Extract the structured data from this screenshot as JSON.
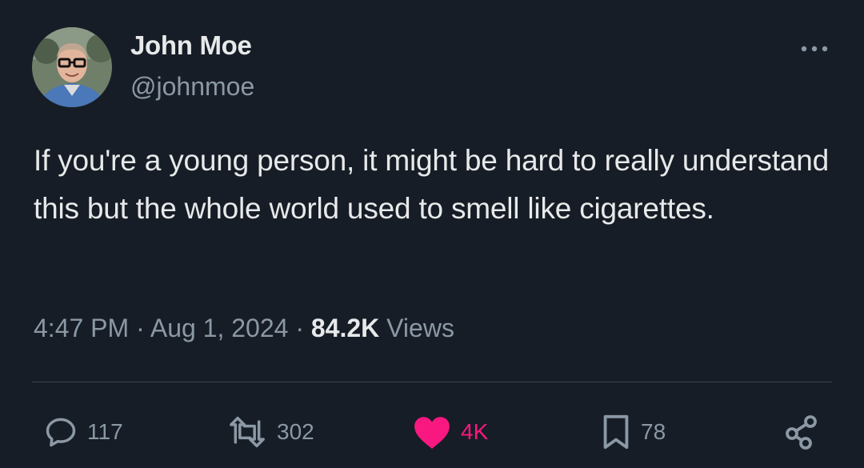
{
  "author": {
    "display_name": "John Moe",
    "handle": "@johnmoe",
    "avatar": "profile-photo"
  },
  "tweet": {
    "text": "If you're a young person, it might be hard to really understand this but the whole world used to smell like cigarettes.",
    "time": "4:47 PM",
    "separator1": " · ",
    "date": "Aug 1, 2024",
    "separator2": " · ",
    "views_count": "84.2K",
    "views_label": " Views"
  },
  "actions": {
    "reply": {
      "icon": "reply-icon",
      "count": "117"
    },
    "retweet": {
      "icon": "retweet-icon",
      "count": "302"
    },
    "like": {
      "icon": "heart-icon",
      "count": "4K",
      "active": true
    },
    "bookmark": {
      "icon": "bookmark-icon",
      "count": "78"
    },
    "share": {
      "icon": "share-icon"
    }
  },
  "colors": {
    "background": "#171d26",
    "text_primary": "#e7e9ea",
    "text_secondary": "#8b98a5",
    "like_active": "#f91880",
    "divider": "#38444d"
  }
}
